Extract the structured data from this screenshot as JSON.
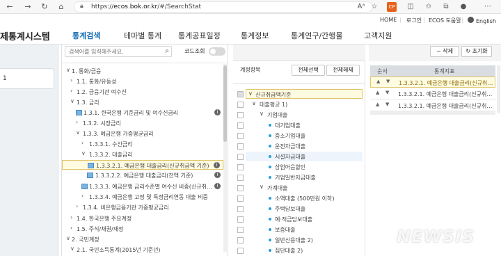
{
  "browser": {
    "url_prefix": "https://",
    "url_host": "ecos.bok.or.kr",
    "url_path": "/#/SearchStat",
    "lock_icon": "lock-icon",
    "ext_label": "CP",
    "reader_label": "Aᵃ"
  },
  "toplinks": {
    "home": "HOME",
    "login": "로그인",
    "help": "ECOS 도움말",
    "language": "English"
  },
  "header": {
    "logo": "제통계시스템",
    "menu": [
      "통계검색",
      "테마별 통계",
      "통계공표일정",
      "통계정보",
      "통계연구/간행물",
      "고객지원"
    ]
  },
  "left_panel": {
    "box_text": "1"
  },
  "tree": {
    "search_placeholder": "검색어를 입력해주세요.",
    "code_toggle_label": "코드조회",
    "rows": [
      {
        "arrow": "∨",
        "text": "1. 통화/금융"
      },
      {
        "arrow": "›",
        "text": "1.1. 통화/유동성"
      },
      {
        "arrow": "›",
        "text": "1.2. 금융기관 여수신"
      },
      {
        "arrow": "∨",
        "text": "1.3. 금리"
      },
      {
        "arrow": "",
        "text": "1.3.1. 한국은행 기준금리 및 여수신금리"
      },
      {
        "arrow": "›",
        "text": "1.3.2. 시장금리"
      },
      {
        "arrow": "∨",
        "text": "1.3.3. 예금은행 가중평균금리"
      },
      {
        "arrow": "›",
        "text": "1.3.3.1. 수신금리"
      },
      {
        "arrow": "∨",
        "text": "1.3.3.2. 대출금리"
      },
      {
        "arrow": "",
        "text": "1.3.3.2.1. 예금은행 대출금리(신규취급액 기준)"
      },
      {
        "arrow": "",
        "text": "1.3.3.2.2. 예금은행 대출금리(잔액 기준)"
      },
      {
        "arrow": "",
        "text": "1.3.3.3. 예금은행 금리수준별 여수신 비중(신규취…"
      },
      {
        "arrow": "›",
        "text": "1.3.3.4. 예금은행 고정 및 특정금리연동 대출 비중"
      },
      {
        "arrow": "›",
        "text": "1.3.4. 비은행금융기관 가중평균금리"
      },
      {
        "arrow": "›",
        "text": "1.4. 한국은행 주요계정"
      },
      {
        "arrow": "›",
        "text": "1.5. 주식/채권/재정"
      },
      {
        "arrow": "∨",
        "text": "2. 국민계정"
      },
      {
        "arrow": "∨",
        "text": "2.1. 국민소득통계(2015년 기준년)"
      }
    ]
  },
  "items": {
    "header": "계정항목",
    "select_all": "전체선택",
    "deselect_all": "전체해제",
    "rows": [
      {
        "arrow": "∨",
        "text": "신규취급액기준"
      },
      {
        "arrow": "∨",
        "text": "대출평균 1)"
      },
      {
        "arrow": "∨",
        "text": "기업대출"
      },
      {
        "arrow": "",
        "text": "대기업대출"
      },
      {
        "arrow": "",
        "text": "중소기업대출"
      },
      {
        "arrow": "",
        "text": "운전자금대출"
      },
      {
        "arrow": "",
        "text": "시설자금대출"
      },
      {
        "arrow": "",
        "text": "상업어음할인"
      },
      {
        "arrow": "",
        "text": "기업일반자금대출"
      },
      {
        "arrow": "∨",
        "text": "가계대출"
      },
      {
        "arrow": "",
        "text": "소액대출 (500만원 이하)"
      },
      {
        "arrow": "",
        "text": "주택담보대출"
      },
      {
        "arrow": "",
        "text": "예·적금담보대출"
      },
      {
        "arrow": "",
        "text": "보증대출"
      },
      {
        "arrow": "",
        "text": "일반신용대출 2)"
      },
      {
        "arrow": "",
        "text": "집단대출 2)"
      }
    ]
  },
  "selected": {
    "delete_label": "삭제",
    "reset_label": "초기화",
    "col_order": "순서",
    "col_item": "통계지표",
    "rows": [
      "1.3.3.2.1. 예금은행 대출금리(신규취…",
      "1.3.3.2.1. 예금은행 대출금리(신규취…",
      "1.3.3.2.1. 예금은행 대출금리(신규취…"
    ]
  },
  "watermark": "NEWSIS",
  "colors": {
    "accent": "#1a6fb5",
    "selection_bg": "#fffbe0",
    "selection_border": "#e2c46a",
    "table_icon": "#7ab4e0",
    "bullet": "#2a9fd6"
  }
}
